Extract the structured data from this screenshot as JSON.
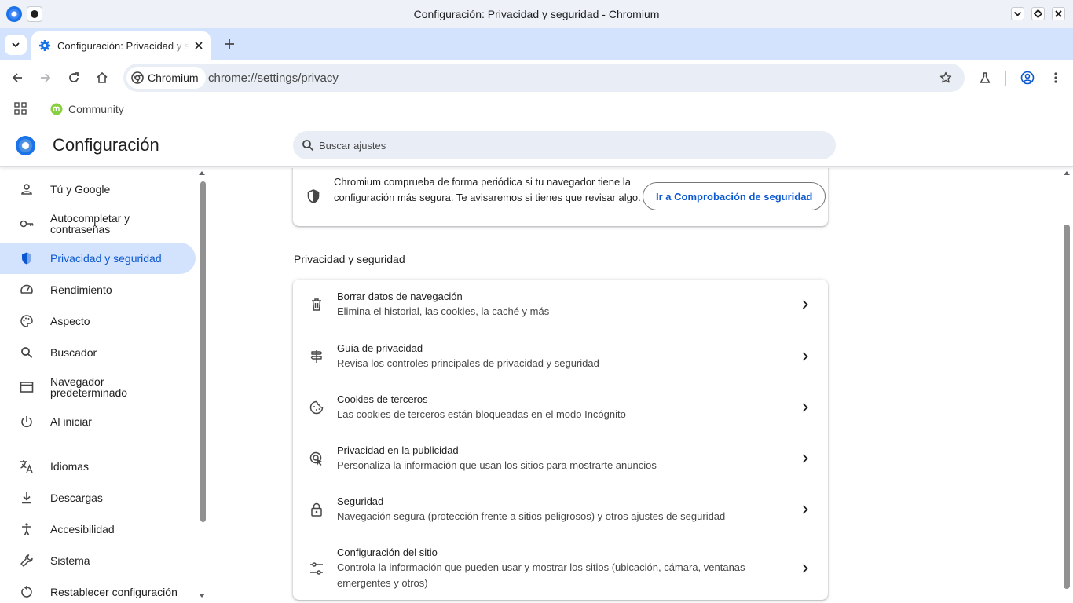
{
  "window": {
    "title": "Configuración: Privacidad y seguridad - Chromium"
  },
  "tab": {
    "title": "Configuración: Privacidad y seguridad"
  },
  "toolbar": {
    "chip_label": "Chromium",
    "url": "chrome://settings/privacy"
  },
  "bookmarks": {
    "items": [
      {
        "label": "Community"
      }
    ]
  },
  "settings": {
    "title": "Configuración",
    "search_placeholder": "Buscar ajustes"
  },
  "sidebar": {
    "items": [
      {
        "label": "Tú y Google",
        "icon": "person-icon",
        "active": false
      },
      {
        "label": "Autocompletar y contraseñas",
        "icon": "key-icon",
        "active": false
      },
      {
        "label": "Privacidad y seguridad",
        "icon": "shield-icon",
        "active": true
      },
      {
        "label": "Rendimiento",
        "icon": "speedometer-icon",
        "active": false
      },
      {
        "label": "Aspecto",
        "icon": "palette-icon",
        "active": false
      },
      {
        "label": "Buscador",
        "icon": "search-icon",
        "active": false
      },
      {
        "label": "Navegador predeterminado",
        "icon": "browser-window-icon",
        "active": false
      },
      {
        "label": "Al iniciar",
        "icon": "power-icon",
        "active": false
      },
      {
        "label": "Idiomas",
        "icon": "translate-icon",
        "active": false
      },
      {
        "label": "Descargas",
        "icon": "download-icon",
        "active": false
      },
      {
        "label": "Accesibilidad",
        "icon": "accessibility-icon",
        "active": false
      },
      {
        "label": "Sistema",
        "icon": "wrench-icon",
        "active": false
      },
      {
        "label": "Restablecer configuración",
        "icon": "reset-icon",
        "active": false
      }
    ]
  },
  "safety_check": {
    "text": "Chromium comprueba de forma periódica si tu navegador tiene la configuración más segura. Te avisaremos si tienes que revisar algo.",
    "button_label": "Ir a Comprobación de seguridad"
  },
  "privacy_section": {
    "title": "Privacidad y seguridad",
    "rows": [
      {
        "title": "Borrar datos de navegación",
        "subtitle": "Elimina el historial, las cookies, la caché y más",
        "icon": "trash-icon"
      },
      {
        "title": "Guía de privacidad",
        "subtitle": "Revisa los controles principales de privacidad y seguridad",
        "icon": "signpost-icon"
      },
      {
        "title": "Cookies de terceros",
        "subtitle": "Las cookies de terceros están bloqueadas en el modo Incógnito",
        "icon": "cookie-icon"
      },
      {
        "title": "Privacidad en la publicidad",
        "subtitle": "Personaliza la información que usan los sitios para mostrarte anuncios",
        "icon": "ad-privacy-icon"
      },
      {
        "title": "Seguridad",
        "subtitle": "Navegación segura (protección frente a sitios peligrosos) y otros ajustes de seguridad",
        "icon": "lock-icon"
      },
      {
        "title": "Configuración del sitio",
        "subtitle": "Controla la información que pueden usar y mostrar los sitios (ubicación, cámara, ventanas emergentes y otros)",
        "icon": "sliders-icon"
      }
    ]
  },
  "colors": {
    "accent": "#0b57d0",
    "active_bg": "#d3e3fd",
    "tabstrip_bg": "#d3e3fd",
    "omnibox_bg": "#e9eef6"
  }
}
